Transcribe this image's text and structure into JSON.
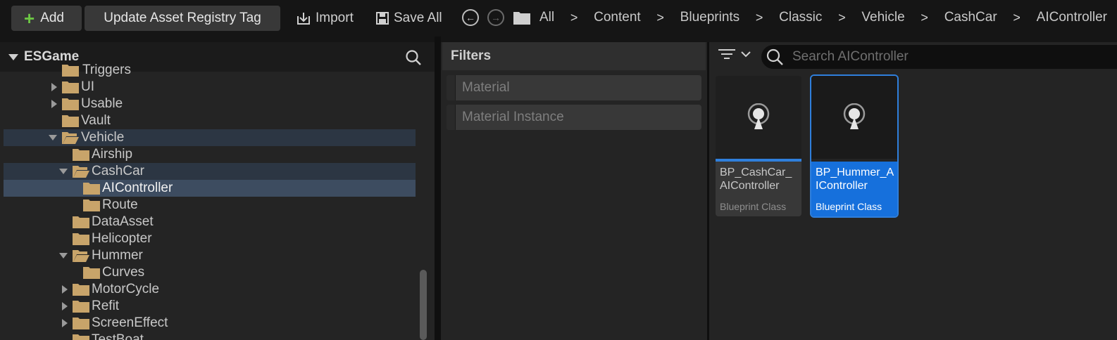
{
  "toolbar": {
    "add_label": "Add",
    "update_tag_label": "Update Asset Registry Tag",
    "import_label": "Import",
    "save_all_label": "Save All",
    "breadcrumbs": [
      "All",
      "Content",
      "Blueprints",
      "Classic",
      "Vehicle",
      "CashCar",
      "AIController"
    ],
    "separator": ">"
  },
  "tree": {
    "root": "ESGame",
    "items": [
      {
        "label": "Triggers",
        "state": "partial"
      },
      {
        "label": "UI",
        "state": "collapsed"
      },
      {
        "label": "Usable",
        "state": "collapsed"
      },
      {
        "label": "Vault",
        "state": "leaf"
      },
      {
        "label": "Vehicle",
        "state": "expanded"
      },
      {
        "label": "Airship",
        "state": "leaf"
      },
      {
        "label": "CashCar",
        "state": "expanded"
      },
      {
        "label": "AIController",
        "state": "selected"
      },
      {
        "label": "Route",
        "state": "leaf"
      },
      {
        "label": "DataAsset",
        "state": "leaf"
      },
      {
        "label": "Helicopter",
        "state": "leaf"
      },
      {
        "label": "Hummer",
        "state": "expanded"
      },
      {
        "label": "Curves",
        "state": "leaf"
      },
      {
        "label": "MotorCycle",
        "state": "collapsed"
      },
      {
        "label": "Refit",
        "state": "collapsed"
      },
      {
        "label": "ScreenEffect",
        "state": "collapsed"
      },
      {
        "label": "TestBoat",
        "state": "partial"
      }
    ]
  },
  "filters": {
    "title": "Filters",
    "items": [
      "Material",
      "Material Instance"
    ]
  },
  "content": {
    "search_placeholder": "Search AIController",
    "assets": [
      {
        "name": "BP_CashCar_AIController",
        "type": "Blueprint Class",
        "selected": false
      },
      {
        "name": "BP_Hummer_AIController",
        "type": "Blueprint Class",
        "selected": true
      }
    ]
  },
  "colors": {
    "accent_blue": "#1670dc",
    "folder": "#c8a46a",
    "add_green": "#6cc644"
  }
}
